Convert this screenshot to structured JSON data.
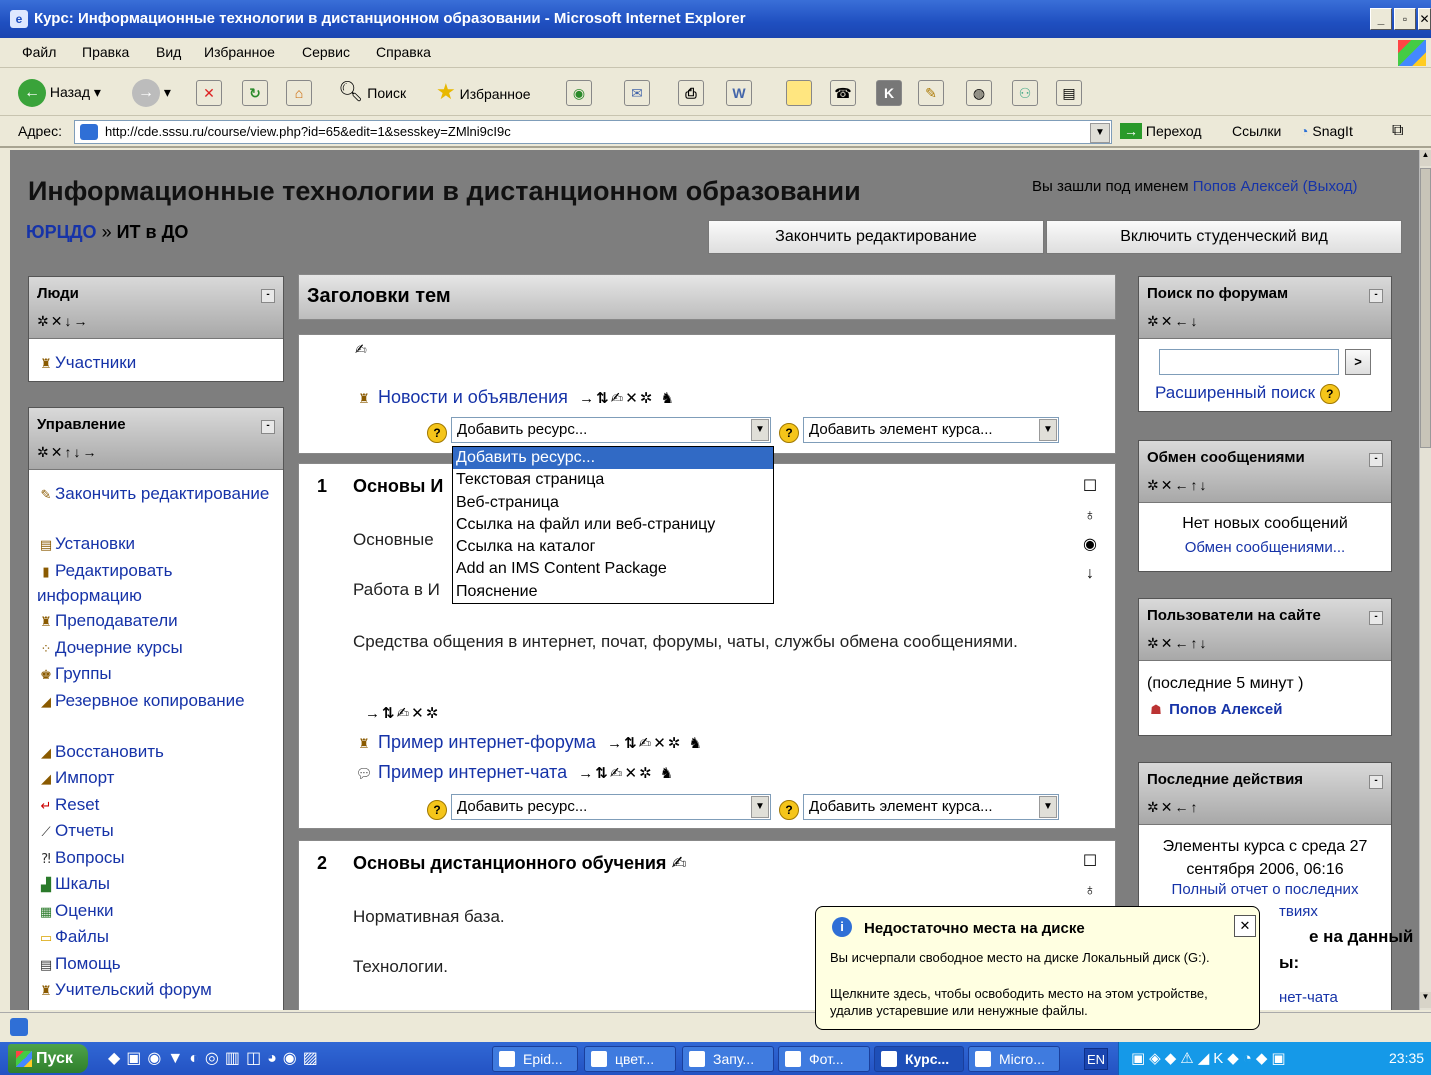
{
  "window": {
    "title": "Курс: Информационные технологии в дистанционном образовании - Microsoft Internet Explorer"
  },
  "menu": [
    "Файл",
    "Правка",
    "Вид",
    "Избранное",
    "Сервис",
    "Справка"
  ],
  "toolbar": {
    "back": "Назад",
    "search": "Поиск",
    "favorites": "Избранное"
  },
  "addressbar": {
    "label": "Адрес:",
    "url": "http://cde.sssu.ru/course/view.php?id=65&edit=1&sesskey=ZMlni9cI9c",
    "go": "Переход",
    "links": "Ссылки",
    "snagit": "SnagIt"
  },
  "page": {
    "title": "Информационные технологии в дистанционном образовании",
    "login_prefix": "Вы зашли под именем",
    "login_user": "Попов Алексей",
    "logout": "(Выход)",
    "breadcrumb_root": "ЮРЦДО",
    "breadcrumb_sep": "»",
    "breadcrumb_current": "ИТ в ДО",
    "btn_finish": "Закончить редактирование",
    "btn_student": "Включить студенческий вид"
  },
  "people": {
    "title": "Люди",
    "controls": "✲✕↓→",
    "participants": "Участники"
  },
  "admin": {
    "title": "Управление",
    "controls": "✲✕↑↓→",
    "items": [
      "Закончить редактирование",
      "Установки",
      "Редактировать информацию",
      "Преподаватели",
      "Дочерние курсы",
      "Группы",
      "Резервное копирование",
      "Восстановить",
      "Импорт",
      "Reset",
      "Отчеты",
      "Вопросы",
      "Шкалы",
      "Оценки",
      "Файлы",
      "Помощь",
      "Учительский форум"
    ]
  },
  "topics": {
    "header": "Заголовки тем",
    "news": "Новости и объявления",
    "add_resource": "Добавить ресурс...",
    "add_activity": "Добавить элемент курса...",
    "t1_num": "1",
    "t1_title": "Основы И",
    "t1_line1": "Основные",
    "t1_line2": "Работа в И",
    "t1_line3": "Средства общения в интернет, почат, форумы, чаты, службы обмена сообщениями.",
    "forum": "Пример интернет-форума",
    "chat": "Пример интернет-чата",
    "t2_num": "2",
    "t2_title": "Основы дистанционного обучения",
    "t2_line1": "Нормативная база.",
    "t2_line2": "Технологии."
  },
  "dropdown": [
    "Добавить ресурс...",
    "Текстовая страница",
    "Веб-страница",
    "Ссылка на файл или веб-страницу",
    "Ссылка на каталог",
    "Add an IMS Content Package",
    "Пояснение"
  ],
  "search_forums": {
    "title": "Поиск по форумам",
    "go": ">",
    "advanced": "Расширенный поиск"
  },
  "messages": {
    "title": "Обмен сообщениями",
    "none": "Нет новых сообщений",
    "link": "Обмен сообщениями..."
  },
  "online": {
    "title": "Пользователи на сайте",
    "period": "(последние 5 минут )",
    "user": "Попов Алексей"
  },
  "recent": {
    "title": "Последние действия",
    "since": "Элементы курса с среда 27 сентября 2006, 06:16",
    "report": "Полный отчет о последних",
    "report2": "твиях",
    "bold": "е на данный",
    "bold2": "ы:",
    "chat": "нет-чата"
  },
  "balloon": {
    "title": "Недостаточно места на диске",
    "text1": "Вы исчерпали свободное место на диске Локальный диск (G:).",
    "text2": "Щелкните здесь, чтобы освободить место на этом устройстве, удалив устаревшие или ненужные файлы."
  },
  "taskbar": {
    "start": "Пуск",
    "tasks": [
      "Epid...",
      "цвет...",
      "Запу...",
      "Фот...",
      "Курс...",
      "Micro..."
    ],
    "lang": "EN",
    "clock": "23:35"
  }
}
